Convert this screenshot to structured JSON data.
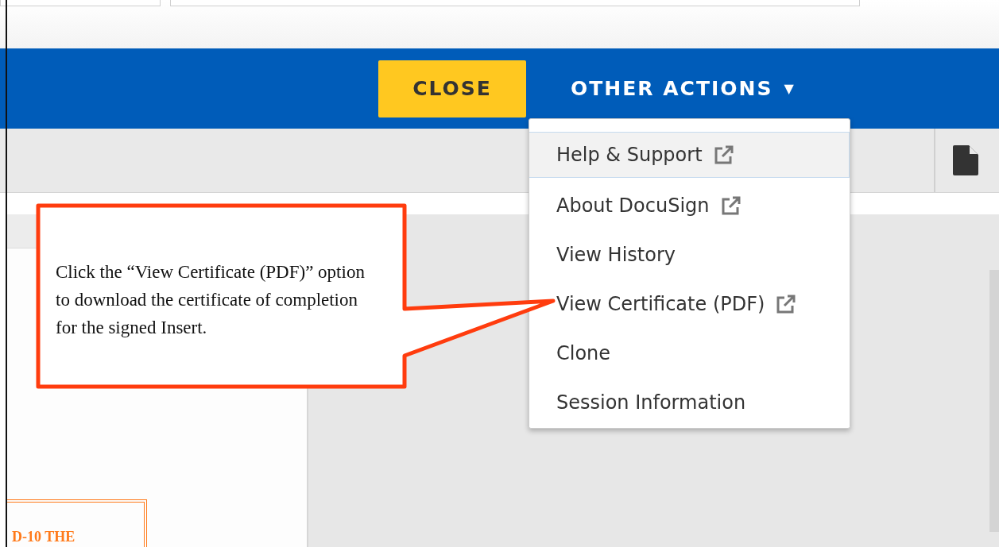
{
  "header": {
    "close_button": "CLOSE",
    "other_actions": {
      "label": "OTHER ACTIONS",
      "caret": "▼"
    }
  },
  "menu": {
    "items": [
      {
        "label": "Help & Support",
        "external": true,
        "highlighted": true
      },
      {
        "label": "About DocuSign",
        "external": true,
        "highlighted": false
      },
      {
        "label": "View History",
        "external": false,
        "highlighted": false
      },
      {
        "label": "View Certificate (PDF)",
        "external": true,
        "highlighted": false
      },
      {
        "label": "Clone",
        "external": false,
        "highlighted": false
      },
      {
        "label": "Session Information",
        "external": false,
        "highlighted": false
      }
    ]
  },
  "document": {
    "stamp_text": "D-10 THE"
  },
  "callout": {
    "text": "Click the “View Certificate (PDF)” option to download the certificate of completion for the signed Insert."
  }
}
